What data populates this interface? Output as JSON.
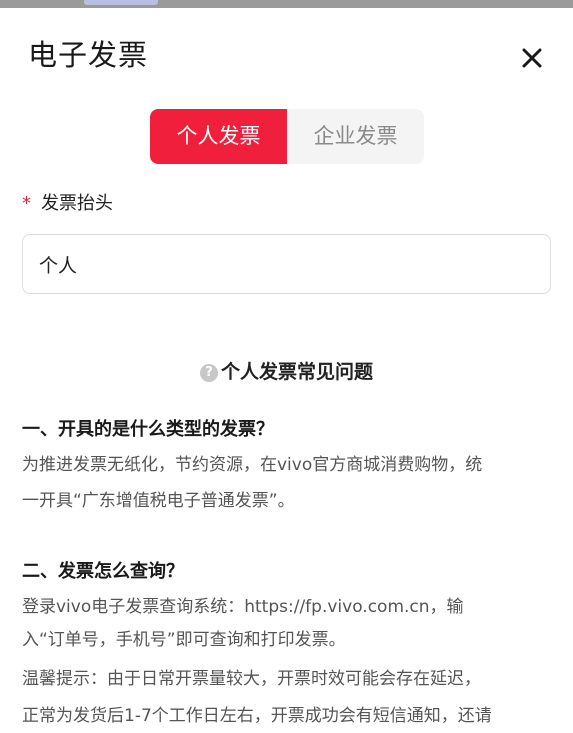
{
  "panel": {
    "title": "电子发票"
  },
  "invoice_type_tabs": [
    {
      "label": "个人发票",
      "active": true
    },
    {
      "label": "企业发票",
      "active": false
    }
  ],
  "header_field": {
    "required_mark": "*",
    "label": "发票抬头",
    "value": "个人"
  },
  "faq": {
    "heading": "个人发票常见问题",
    "help_icon_glyph": "?",
    "items": [
      {
        "question": "一、开具的是什么类型的发票？",
        "answer_lines": [
          "为推进发票无纸化，节约资源，在vivo官方商城消费购物，统",
          "一开具“广东增值税电子普通发票”。"
        ]
      },
      {
        "question": "二、发票怎么查询？",
        "answer_lines": [
          "登录vivo电子发票查询系统：https://fp.vivo.com.cn，输",
          "入“订单号，手机号”即可查询和打印发票。",
          "温馨提示：由于日常开票量较大，开票时效可能会存在延迟，",
          "正常为发货后1-7个工作日左右，开票成功会有短信通知，还请"
        ]
      }
    ]
  },
  "colors": {
    "accent": "#f01f3c",
    "tab_inactive_bg": "#f4f4f4",
    "overlay": "#9a9a9a"
  }
}
